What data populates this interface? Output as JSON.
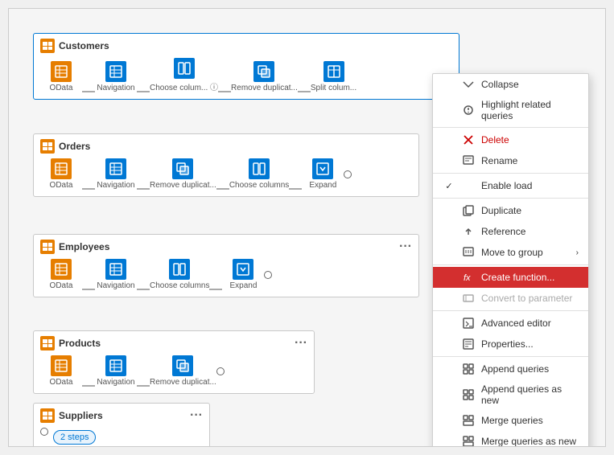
{
  "panels": {
    "customers": {
      "title": "Customers",
      "steps": [
        {
          "label": "OData",
          "type": "odata"
        },
        {
          "label": "Navigation",
          "type": "nav"
        },
        {
          "label": "Choose colum...",
          "type": "choose"
        },
        {
          "label": "Remove duplicat...",
          "type": "remove"
        },
        {
          "label": "Split colum...",
          "type": "split"
        }
      ]
    },
    "orders": {
      "title": "Orders",
      "steps": [
        {
          "label": "OData",
          "type": "odata"
        },
        {
          "label": "Navigation",
          "type": "nav"
        },
        {
          "label": "Remove duplicat...",
          "type": "remove"
        },
        {
          "label": "Choose columns",
          "type": "choose"
        },
        {
          "label": "Expand",
          "type": "expand"
        }
      ]
    },
    "employees": {
      "title": "Employees",
      "steps": [
        {
          "label": "OData",
          "type": "odata"
        },
        {
          "label": "Navigation",
          "type": "nav"
        },
        {
          "label": "Choose columns",
          "type": "choose"
        },
        {
          "label": "Expand",
          "type": "expand"
        }
      ]
    },
    "products": {
      "title": "Products",
      "steps": [
        {
          "label": "OData",
          "type": "odata"
        },
        {
          "label": "Navigation",
          "type": "nav"
        },
        {
          "label": "Remove duplicat...",
          "type": "remove"
        }
      ]
    },
    "suppliers": {
      "title": "Suppliers",
      "badge": "2 steps"
    }
  },
  "contextMenu": {
    "items": [
      {
        "id": "collapse",
        "label": "Collapse",
        "icon": "collapse",
        "type": "item"
      },
      {
        "id": "highlight",
        "label": "Highlight related queries",
        "icon": "highlight",
        "type": "item"
      },
      {
        "id": "sep1",
        "type": "separator"
      },
      {
        "id": "delete",
        "label": "Delete",
        "icon": "delete",
        "type": "item",
        "color": "red"
      },
      {
        "id": "rename",
        "label": "Rename",
        "icon": "rename",
        "type": "item"
      },
      {
        "id": "sep2",
        "type": "separator"
      },
      {
        "id": "enable-load",
        "label": "Enable load",
        "icon": "check",
        "type": "item",
        "checked": true
      },
      {
        "id": "sep3",
        "type": "separator"
      },
      {
        "id": "duplicate",
        "label": "Duplicate",
        "icon": "duplicate",
        "type": "item"
      },
      {
        "id": "reference",
        "label": "Reference",
        "icon": "reference",
        "type": "item"
      },
      {
        "id": "move-to-group",
        "label": "Move to group",
        "icon": "move",
        "type": "item",
        "hasArrow": true
      },
      {
        "id": "sep4",
        "type": "separator"
      },
      {
        "id": "create-function",
        "label": "Create function...",
        "icon": "function",
        "type": "item",
        "highlighted": true
      },
      {
        "id": "convert-to-param",
        "label": "Convert to parameter",
        "icon": "convert",
        "type": "item",
        "disabled": true
      },
      {
        "id": "sep5",
        "type": "separator"
      },
      {
        "id": "advanced-editor",
        "label": "Advanced editor",
        "icon": "editor",
        "type": "item"
      },
      {
        "id": "properties",
        "label": "Properties...",
        "icon": "properties",
        "type": "item"
      },
      {
        "id": "sep6",
        "type": "separator"
      },
      {
        "id": "append-queries",
        "label": "Append queries",
        "icon": "append",
        "type": "item"
      },
      {
        "id": "append-queries-new",
        "label": "Append queries as new",
        "icon": "append-new",
        "type": "item"
      },
      {
        "id": "merge-queries",
        "label": "Merge queries",
        "icon": "merge",
        "type": "item"
      },
      {
        "id": "merge-queries-new",
        "label": "Merge queries as new",
        "icon": "merge-new",
        "type": "item"
      }
    ]
  }
}
